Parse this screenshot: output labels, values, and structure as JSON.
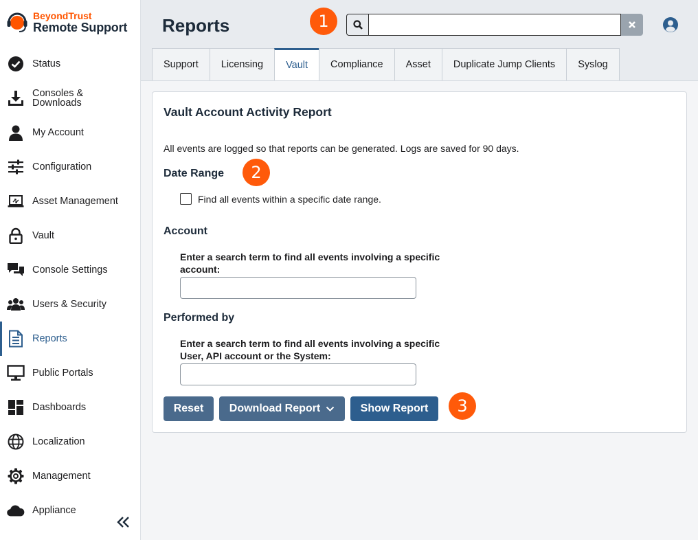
{
  "brand": {
    "company": "BeyondTrust",
    "product": "Remote Support"
  },
  "sidebar": {
    "items": [
      {
        "label": "Status",
        "icon": "check-circle-icon"
      },
      {
        "label": "Consoles &\nDownloads",
        "icon": "download-icon"
      },
      {
        "label": "My Account",
        "icon": "person-icon"
      },
      {
        "label": "Configuration",
        "icon": "sliders-icon"
      },
      {
        "label": "Asset Management",
        "icon": "laptop-icon"
      },
      {
        "label": "Vault",
        "icon": "lock-icon"
      },
      {
        "label": "Console Settings",
        "icon": "chat-icon"
      },
      {
        "label": "Users & Security",
        "icon": "users-icon"
      },
      {
        "label": "Reports",
        "icon": "report-icon",
        "active": true
      },
      {
        "label": "Public Portals",
        "icon": "monitor-icon"
      },
      {
        "label": "Dashboards",
        "icon": "dashboard-icon"
      },
      {
        "label": "Localization",
        "icon": "globe-icon"
      },
      {
        "label": "Management",
        "icon": "gear-icon"
      },
      {
        "label": "Appliance",
        "icon": "cloud-icon"
      }
    ]
  },
  "header": {
    "title": "Reports",
    "search": {
      "value": "",
      "placeholder": ""
    }
  },
  "callouts": [
    "1",
    "2",
    "3"
  ],
  "tabs": [
    {
      "label": "Support"
    },
    {
      "label": "Licensing"
    },
    {
      "label": "Vault",
      "active": true
    },
    {
      "label": "Compliance"
    },
    {
      "label": "Asset"
    },
    {
      "label": "Duplicate Jump Clients"
    },
    {
      "label": "Syslog"
    }
  ],
  "report": {
    "title": "Vault Account Activity Report",
    "description": "All events are logged so that reports can be generated. Logs are saved for 90 days.",
    "date_range": {
      "heading": "Date Range",
      "checkbox_label": "Find all events within a specific date range.",
      "checked": false
    },
    "account": {
      "heading": "Account",
      "field_label": "Enter a search term to find all events involving a specific account:",
      "value": ""
    },
    "performed_by": {
      "heading": "Performed by",
      "field_label": "Enter a search term to find all events involving a specific User, API account or the System:",
      "value": ""
    },
    "buttons": {
      "reset": "Reset",
      "download": "Download Report",
      "show": "Show Report"
    }
  },
  "colors": {
    "brand_orange": "#ff5500",
    "callout": "#ff5a0a",
    "primary": "#2d5e8e",
    "secondary": "#4a6a8c"
  }
}
